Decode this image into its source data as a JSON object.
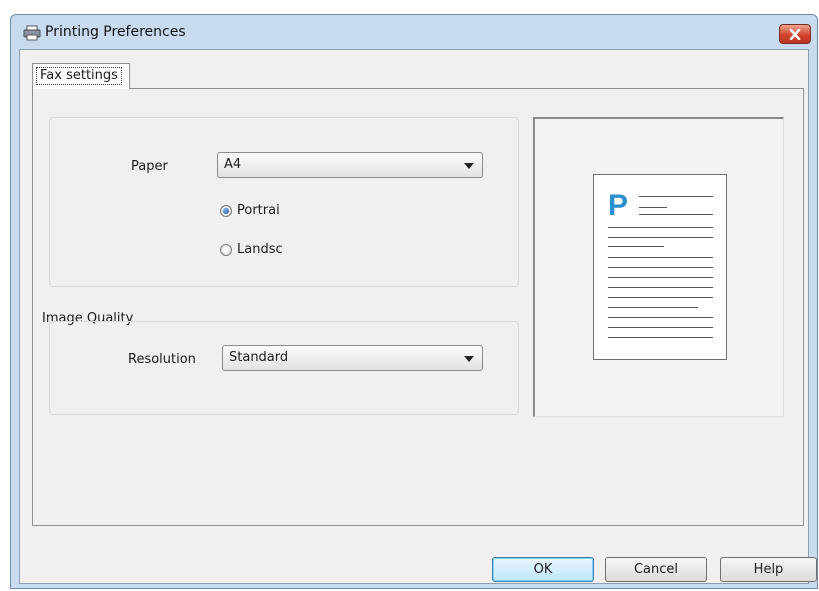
{
  "window": {
    "title": "Printing Preferences",
    "icon": "printer-icon",
    "close_icon": "close-icon"
  },
  "tabs": [
    {
      "label": "Fax settings",
      "selected": true
    }
  ],
  "paper": {
    "label": "Paper",
    "value": "A4",
    "orientation": [
      {
        "label": "Portrai",
        "checked": true
      },
      {
        "label": "Landsc",
        "checked": false
      }
    ]
  },
  "image_quality": {
    "group_label": "Image Quality",
    "resolution_label": "Resolution",
    "resolution_value": "Standard"
  },
  "preview": {
    "page_letter": "P"
  },
  "buttons": {
    "ok": "OK",
    "cancel": "Cancel",
    "help": "Help"
  },
  "colors": {
    "accent": "#2e8fce",
    "close": "#d2452f",
    "titlebar": "#c9dcef"
  }
}
